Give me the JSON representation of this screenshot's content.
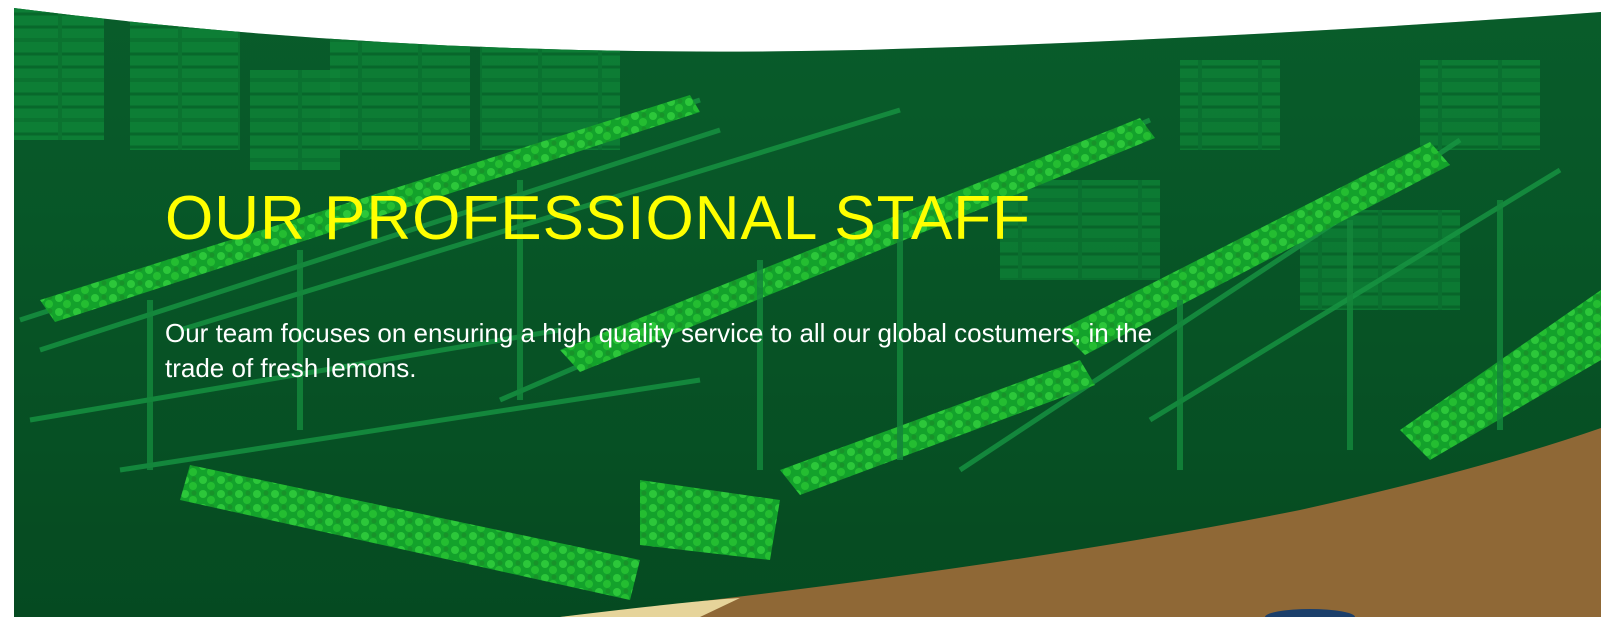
{
  "hero": {
    "title": "OUR PROFESSIONAL STAFF",
    "text": "Our team focuses on ensuring a high quality service to all our global costumers, in the trade of fresh lemons."
  },
  "background": {
    "image": "lemon-sorting-conveyor-photo",
    "overlay": "green-tint",
    "bottom_right_image": "cardboard-box-photo"
  },
  "colors": {
    "title": "#ffff00",
    "text": "#ffffff",
    "overlay": "#006b2a",
    "page": "#ffffff",
    "box": "#8f6836"
  }
}
